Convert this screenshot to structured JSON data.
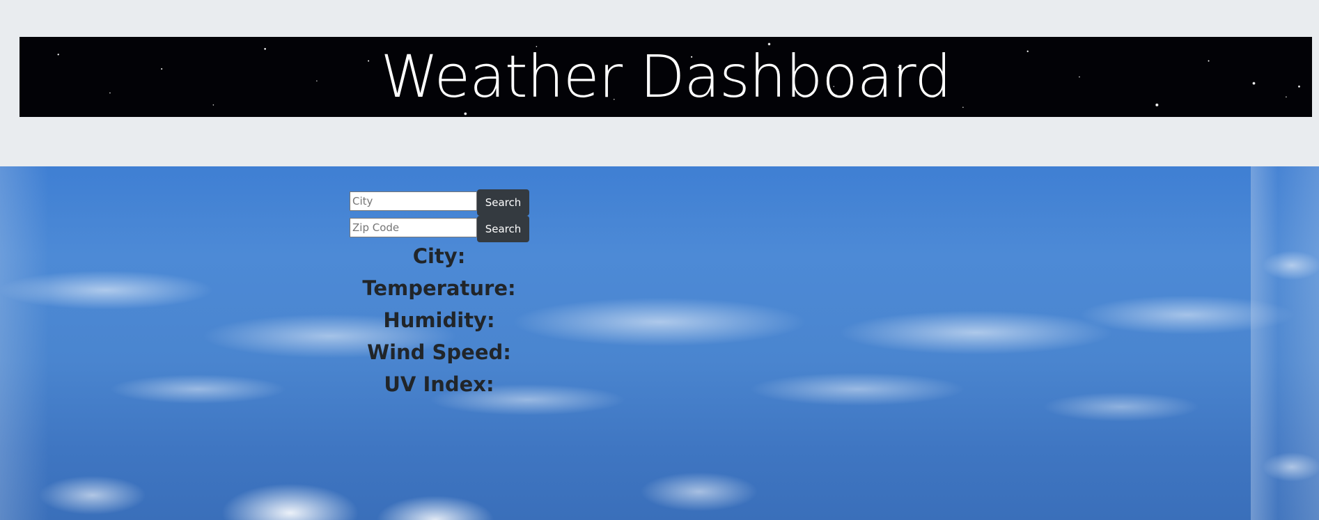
{
  "header": {
    "title": "Weather Dashboard"
  },
  "search": {
    "city_placeholder": "City",
    "city_button": "Search",
    "zip_placeholder": "Zip Code",
    "zip_button": "Search"
  },
  "weather": {
    "city_label": "City:",
    "temperature_label": "Temperature:",
    "humidity_label": "Humidity:",
    "wind_speed_label": "Wind Speed:",
    "uv_index_label": "UV Index:"
  },
  "colors": {
    "jumbotron_bg": "#e9ecef",
    "button_bg": "#343a40",
    "text_dark": "#212529",
    "sky": "#4a85cf"
  }
}
